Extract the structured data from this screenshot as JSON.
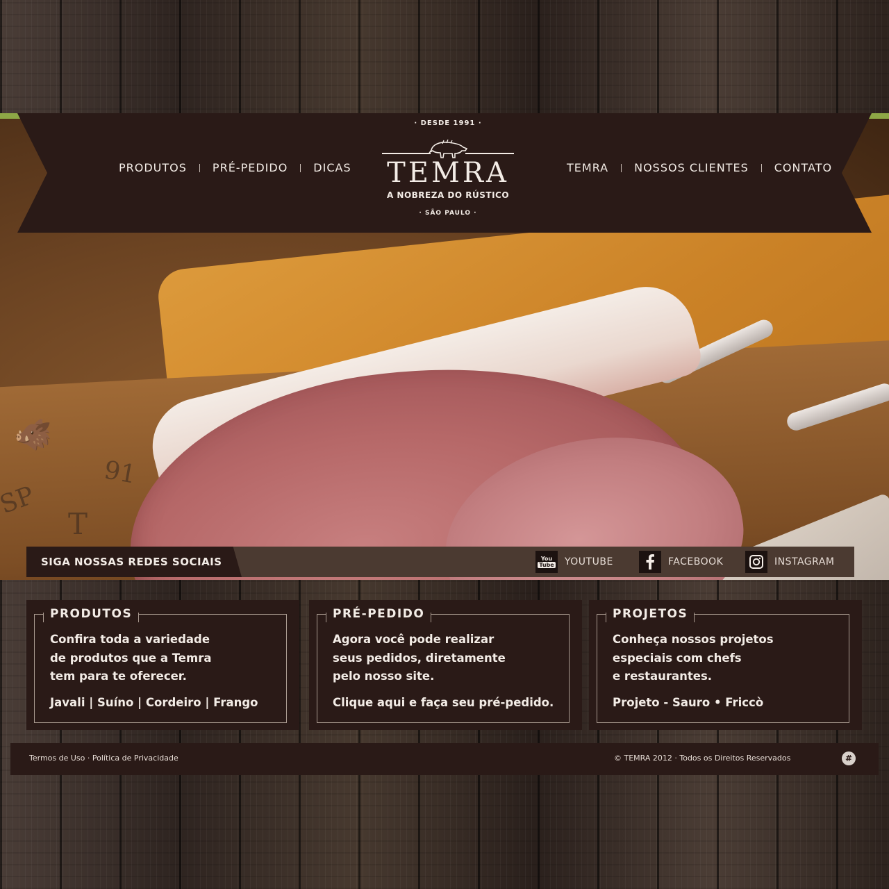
{
  "nav": {
    "left": [
      "PRODUTOS",
      "PRÉ-PEDIDO",
      "DICAS"
    ],
    "right": [
      "TEMRA",
      "NOSSOS CLIENTES",
      "CONTATO"
    ]
  },
  "logo": {
    "since": "· DESDE 1991 ·",
    "brand": "TEMRA",
    "tagline": "A NOBREZA DO RÚSTICO",
    "city": "· SÃO PAULO ·"
  },
  "stamp": {
    "sp": "SP",
    "number": "91",
    "letter": "T"
  },
  "social": {
    "label": "SIGA NOSSAS REDES SOCIAIS",
    "youtube": "YOUTUBE",
    "facebook": "FACEBOOK",
    "instagram": "INSTAGRAM",
    "youtube_icon_text_1": "You",
    "youtube_icon_text_2": "Tube"
  },
  "cards": [
    {
      "title": "PRODUTOS",
      "lines": [
        "Confira toda a variedade",
        "de produtos que a Temra",
        "tem para te oferecer."
      ],
      "link": "Javali | Suíno | Cordeiro | Frango"
    },
    {
      "title": "PRÉ-PEDIDO",
      "lines": [
        "Agora você pode realizar",
        "seus pedidos, diretamente",
        "pelo nosso site."
      ],
      "link": "Clique aqui e faça seu pré-pedido."
    },
    {
      "title": "PROJETOS",
      "lines": [
        "Conheça nossos projetos",
        "especiais com chefs",
        "e restaurantes."
      ],
      "link": "Projeto - Sauro • Friccò"
    }
  ],
  "footer": {
    "terms": "Termos de Uso",
    "separator": "·",
    "privacy": "Política de Privacidade",
    "copyright": "© TEMRA 2012 · Todos os Direitos Reservados",
    "credit_icon_text": "#"
  },
  "colors": {
    "banner": "#2a1a17",
    "social_bar": "#4b3a31",
    "text_light": "#f3ece6",
    "accent_green": "#8ea846"
  }
}
